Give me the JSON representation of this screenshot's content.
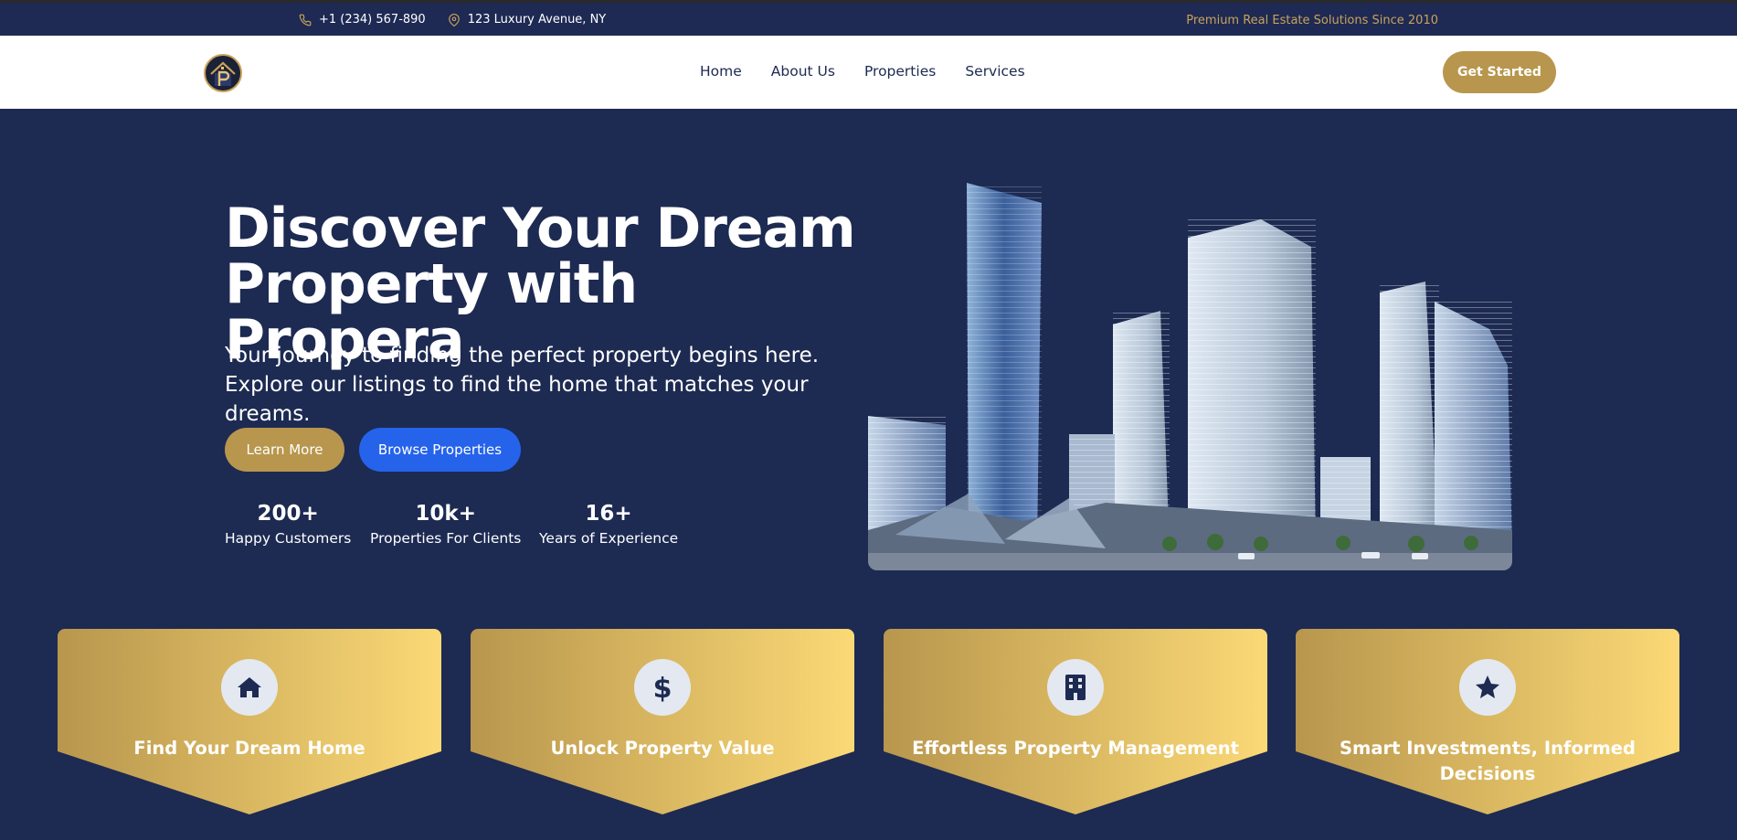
{
  "topbar": {
    "phone": "+1 (234) 567-890",
    "address": "123 Luxury Avenue, NY",
    "tagline": "Premium Real Estate Solutions Since 2010"
  },
  "nav": {
    "items": [
      "Home",
      "About Us",
      "Properties",
      "Services"
    ],
    "cta": "Get Started"
  },
  "hero": {
    "title_line1": "Discover Your Dream",
    "title_line2": "Property with Propera",
    "subtitle": "Your journey to finding the perfect property begins here. Explore our listings to find the home that matches your dreams.",
    "learn_more": "Learn More",
    "browse": "Browse Properties",
    "stats": [
      {
        "value": "200+",
        "label": "Happy Customers"
      },
      {
        "value": "10k+",
        "label": "Properties For Clients"
      },
      {
        "value": "16+",
        "label": "Years of Experience"
      }
    ]
  },
  "features": [
    {
      "icon": "home-icon",
      "title": "Find Your Dream Home"
    },
    {
      "icon": "dollar-icon",
      "title": "Unlock Property Value"
    },
    {
      "icon": "building-icon",
      "title": "Effortless Property Management"
    },
    {
      "icon": "star-icon",
      "title": "Smart Investments, Informed Decisions"
    }
  ],
  "colors": {
    "navy": "#1d2a52",
    "gold": "#b8964d",
    "gold_light": "#fbd976",
    "blue": "#2563eb",
    "tagline": "#c9a25a"
  }
}
